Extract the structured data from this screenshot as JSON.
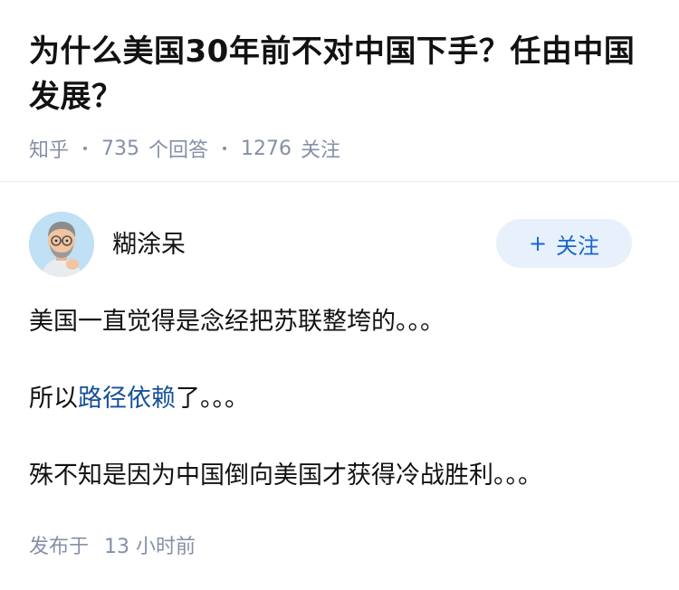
{
  "question": {
    "title": "为什么美国30年前不对中国下手？任由中国发展？",
    "source": "知乎",
    "answer_count": "735",
    "answer_label": "个回答",
    "follow_count": "1276",
    "follow_label": "关注"
  },
  "author": {
    "name": "糊涂呆",
    "avatar_icon": "memoji-avatar-icon",
    "follow_button": {
      "plus": "+",
      "label": "关注"
    }
  },
  "answer": {
    "p1": "美国一直觉得是念经把苏联整垮的。。。",
    "p2_before": "所以",
    "p2_link": "路径依赖",
    "p2_after": "了。。。",
    "p3": "殊不知是因为中国倒向美国才获得冷战胜利。。。"
  },
  "publish": {
    "prefix": "发布于",
    "time": "13 小时前"
  },
  "colors": {
    "link": "#175199",
    "follow_text": "#1668cf",
    "follow_bg": "#e8f1fb",
    "meta": "#8590a6"
  }
}
